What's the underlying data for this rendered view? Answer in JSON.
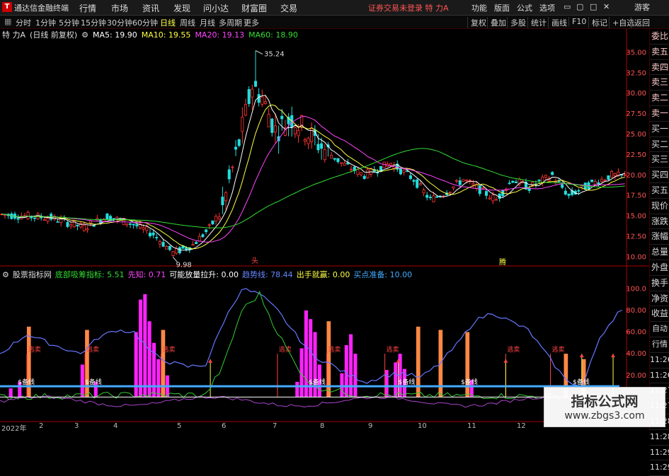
{
  "window": {
    "app_title": "通达信金融终端",
    "menus": [
      "行情",
      "市场",
      "资讯",
      "发现",
      "问小达",
      "财富圈",
      "交易"
    ],
    "notice": "证券交易未登录  特 力A",
    "right_menus": [
      "功能",
      "版面",
      "公式",
      "选项"
    ],
    "guest_label": "游客"
  },
  "period_bar": {
    "periods": [
      "分时",
      "1分钟",
      "5分钟",
      "15分钟",
      "30分钟",
      "60分钟",
      "日线",
      "周线",
      "月线",
      "多周期",
      "更多"
    ],
    "active": "日线",
    "tools": [
      "复权",
      "叠加",
      "多股",
      "统计",
      "画线",
      "F10",
      "标记",
      "+自选",
      "返回"
    ]
  },
  "stock_info": {
    "name": "特 力A",
    "adjust": "(日线 前复权)",
    "ma5": "MA5: 19.90",
    "ma10": "MA10: 19.55",
    "ma20": "MA20: 19.13",
    "ma60": "MA60: 18.90"
  },
  "colors": {
    "up": "#ff3333",
    "down": "#22dddd",
    "ma5": "#ffffff",
    "ma10": "#ffff44",
    "ma20": "#ff44ff",
    "ma60": "#33dd33",
    "axis_frame": "#aa0000"
  },
  "main_chart": {
    "type": "candlestick",
    "y_ticks": [
      "35.00",
      "32.50",
      "30.00",
      "27.50",
      "25.00",
      "22.50",
      "20.00",
      "17.50",
      "15.00",
      "12.50",
      "10.00"
    ],
    "y_tick_values": [
      35.0,
      32.5,
      30.0,
      27.5,
      25.0,
      22.5,
      20.0,
      17.5,
      15.0,
      12.5,
      10.0
    ],
    "ylim": [
      9.0,
      36.5
    ],
    "high_label": "35.24",
    "high_value": 35.24,
    "low_label": "9.98",
    "low_value": 9.98,
    "marker_left": "头",
    "marker_right": "腾"
  },
  "indicator_panel": {
    "name": "股票指标网",
    "items": [
      {
        "label": "底部吸筹指标: 5.51",
        "color": "#33dd33"
      },
      {
        "label": "先知: 0.71",
        "color": "#ff44ff"
      },
      {
        "label": "可能放量拉升: 0.00",
        "color": "#ffffff"
      },
      {
        "label": "趋势线: 78.44",
        "color": "#6688ff"
      },
      {
        "label": "出手就赢: 0.00",
        "color": "#ffff44"
      },
      {
        "label": "买点准备: 10.00",
        "color": "#44aaff"
      }
    ],
    "y_ticks": [
      "100.0",
      "80.00",
      "60.00",
      "40.00",
      "20.00"
    ],
    "y_tick_values": [
      100,
      80,
      60,
      40,
      20
    ],
    "ylim": [
      -20,
      108
    ],
    "buy_ready_label": "$备线",
    "sell_label": "逃卖"
  },
  "sidebar": {
    "items": [
      "委比",
      "卖五",
      "卖四",
      "卖三",
      "卖二",
      "卖一",
      "买一",
      "买二",
      "买三",
      "买四",
      "买五",
      "现价",
      "涨跌",
      "涨幅",
      "总量",
      "外盘",
      "换手",
      "净资",
      "收益"
    ],
    "times": [
      "自动",
      "行情",
      "11:26",
      "11:26",
      "11:27",
      "11:27",
      "11:28",
      "11:28",
      "11:29",
      "11:29"
    ]
  },
  "date_axis": [
    "2022年",
    "2",
    "3",
    "4",
    "5",
    "6",
    "7",
    "8",
    "9",
    "10",
    "11",
    "12"
  ],
  "watermark": {
    "title": "指标公式网",
    "url": "www.zbgs3.com"
  }
}
